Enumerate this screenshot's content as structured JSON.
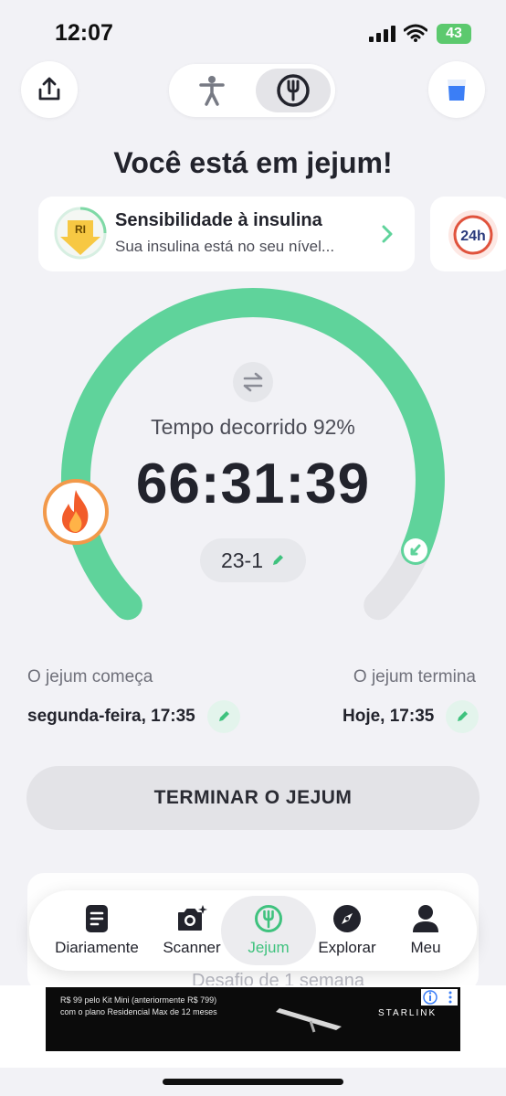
{
  "status_bar": {
    "time": "12:07",
    "battery": "43"
  },
  "header": {
    "title": "Você está em jejum!"
  },
  "insight_card": {
    "icon_text": "RI",
    "title": "Sensibilidade à insulina",
    "subtitle": "Sua insulina está no seu nível...",
    "next_card_icon_text": "24h"
  },
  "fasting": {
    "elapsed_label": "Tempo decorrido 92%",
    "progress_percent": 92,
    "timer": "66:31:39",
    "plan": "23-1",
    "start_label": "O jejum começa",
    "start_value": "segunda-feira, 17:35",
    "end_label": "O jejum termina",
    "end_value": "Hoje, 17:35",
    "end_button": "TERMINAR O JEJUM"
  },
  "behind_card": {
    "text": "Desafio de 1 semana"
  },
  "tabs": [
    {
      "label": "Diariamente",
      "icon": "journal-icon"
    },
    {
      "label": "Scanner",
      "icon": "camera-icon"
    },
    {
      "label": "Jejum",
      "icon": "fork-icon",
      "active": true
    },
    {
      "label": "Explorar",
      "icon": "compass-icon"
    },
    {
      "label": "Meu",
      "icon": "person-icon"
    }
  ],
  "ad": {
    "line1": "R$ 99 pelo Kit Mini (anteriormente R$ 799)",
    "line2": "com o plano Residencial Max de 12 meses",
    "brand": "STARLINK"
  },
  "colors": {
    "accent": "#5fd39b",
    "flame": "#f2994a",
    "track": "#e4e4e8"
  }
}
